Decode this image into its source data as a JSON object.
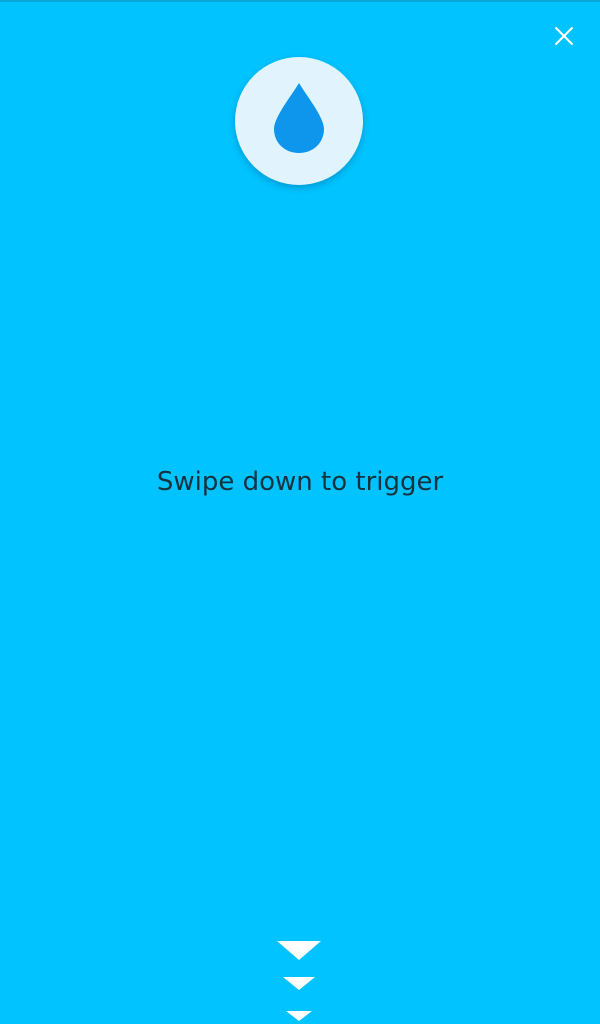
{
  "screen": {
    "background_color": "#00c3ff",
    "instruction": "Swipe down to trigger"
  },
  "close_button": {
    "icon": "close-icon",
    "color": "#ffffff"
  },
  "drop_badge": {
    "icon": "water-drop-icon",
    "circle_color": "#e1f4fd",
    "drop_color": "#0d96ec"
  },
  "swipe_hint": {
    "icon": "chevron-down-icon",
    "count": 3,
    "color": "#ffffff"
  }
}
